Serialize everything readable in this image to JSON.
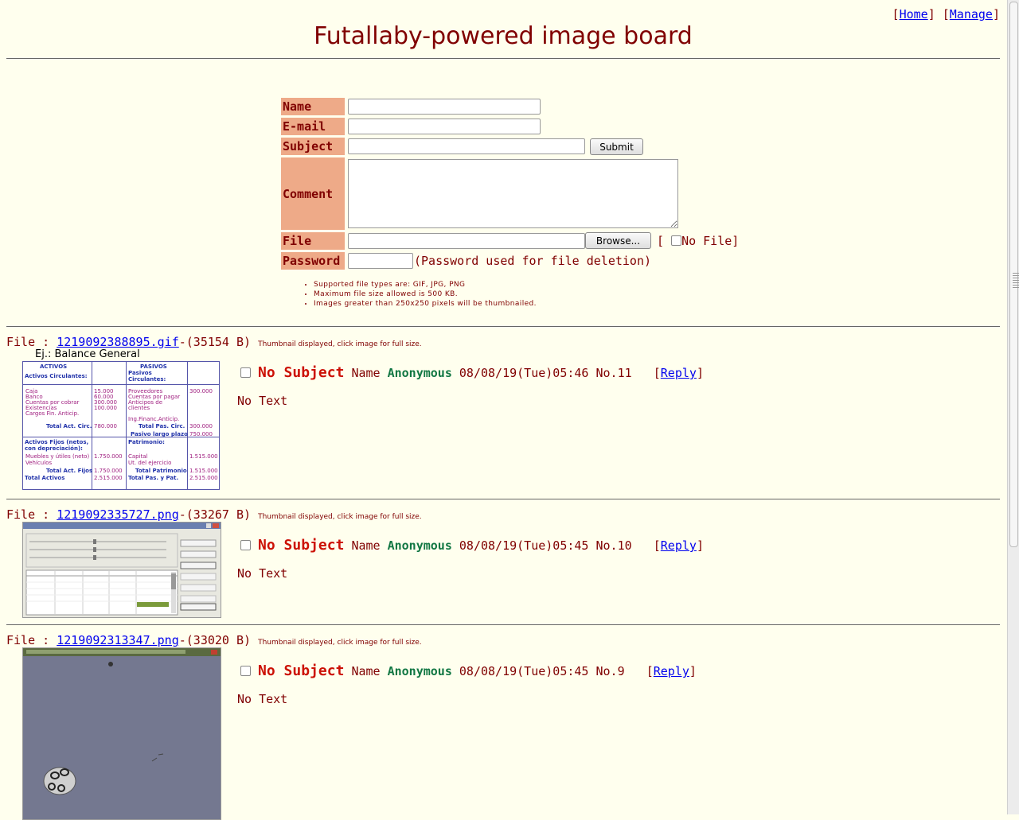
{
  "nav": {
    "home": "Home",
    "manage": "Manage"
  },
  "board_title": "Futallaby-powered image board",
  "form": {
    "name_label": "Name",
    "email_label": "E-mail",
    "subject_label": "Subject",
    "comment_label": "Comment",
    "file_label": "File",
    "password_label": "Password",
    "submit_label": "Submit",
    "browse_label": "Browse...",
    "no_file_label": "No File",
    "password_note": "(Password used for file deletion)"
  },
  "rules": [
    "Supported file types are: GIF, JPG, PNG",
    "Maximum file size allowed is 500 KB.",
    "Images greater than 250x250 pixels will be thumbnailed."
  ],
  "posts": [
    {
      "filename": "1219092388895.gif",
      "filesize": "-(35154 B)",
      "hint": "Thumbnail displayed, click image for full size.",
      "subject": "No Subject",
      "name_label": "Name",
      "name": "Anonymous",
      "datetime": "08/08/19(Tue)05:46",
      "number": "No.11",
      "reply_label": "Reply",
      "text": "No Text",
      "thumb_caption": "Ej.: Balance General",
      "thumb_headers": [
        "ACTIVOS",
        "PASIVOS"
      ]
    },
    {
      "filename": "1219092335727.png",
      "filesize": "-(33267 B)",
      "hint": "Thumbnail displayed, click image for full size.",
      "subject": "No Subject",
      "name_label": "Name",
      "name": "Anonymous",
      "datetime": "08/08/19(Tue)05:45",
      "number": "No.10",
      "reply_label": "Reply",
      "text": "No Text"
    },
    {
      "filename": "1219092313347.png",
      "filesize": "-(33020 B)",
      "hint": "Thumbnail displayed, click image for full size.",
      "subject": "No Subject",
      "name_label": "Name",
      "name": "Anonymous",
      "datetime": "08/08/19(Tue)05:45",
      "number": "No.9",
      "reply_label": "Reply",
      "text": "No Text"
    }
  ]
}
